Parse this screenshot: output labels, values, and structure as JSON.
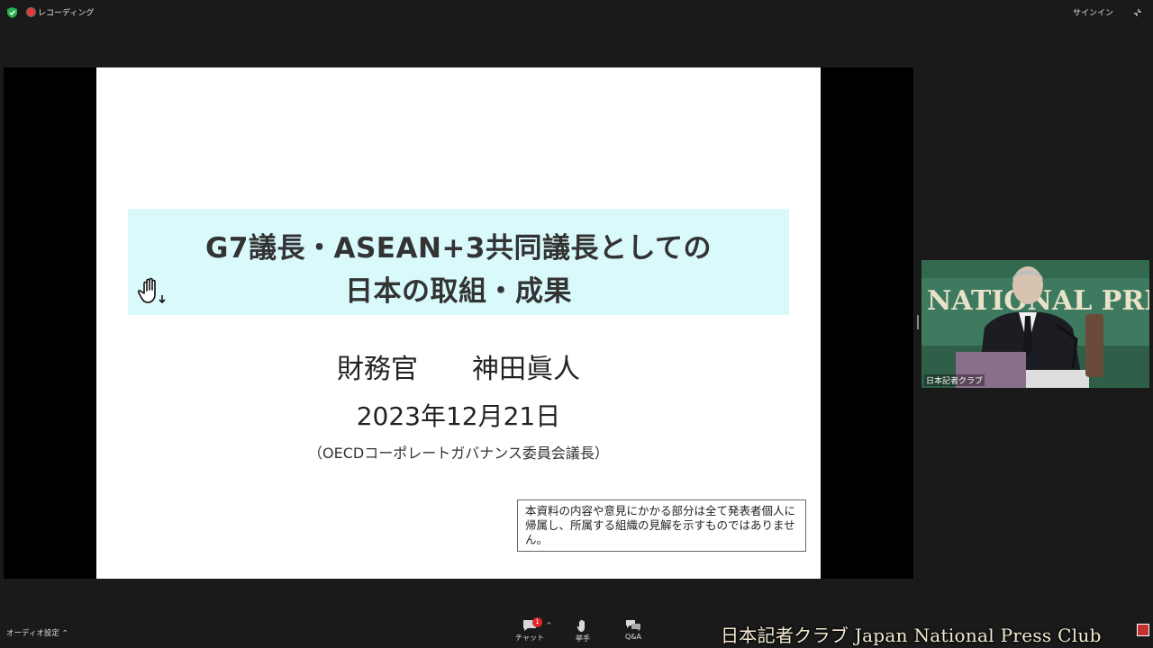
{
  "topbar": {
    "recording_label": "レコーディング",
    "signin_label": "サインイン"
  },
  "slide": {
    "title_line1": "G7議長・ASEAN+3共同議長としての",
    "title_line2": "日本の取組・成果",
    "presenter": "財務官　　神田眞人",
    "date": "2023年12月21日",
    "position": "（OECDコーポレートガバナンス委員会議長）",
    "disclaimer": "本資料の内容や意見にかかる部分は全て発表者個人に帰属し、所属する組織の見解を示すものではありません。"
  },
  "video": {
    "participant_name": "日本記者クラブ",
    "backdrop_text": "NATIONAL PRE"
  },
  "controls": {
    "audio_settings_label": "オーディオ設定",
    "chat_label": "チャット",
    "chat_badge": "1",
    "raise_hand_label": "挙手",
    "qa_label": "Q&A"
  },
  "watermark": "日本記者クラブ Japan National Press Club",
  "colors": {
    "title_background": "#d9f9fb",
    "recording_dot": "#e23b3b",
    "badge": "#e02828"
  }
}
